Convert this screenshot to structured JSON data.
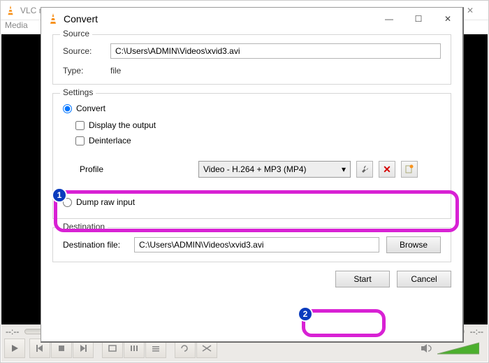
{
  "main": {
    "app_title": "VLC media player",
    "menubar_item": "Media",
    "time_left": "--:--",
    "time_right": "--:--"
  },
  "dialog": {
    "title": "Convert",
    "groups": {
      "source": {
        "legend": "Source",
        "source_label": "Source:",
        "source_value": "C:\\Users\\ADMIN\\Videos\\xvid3.avi",
        "type_label": "Type:",
        "type_value": "file"
      },
      "settings": {
        "legend": "Settings",
        "convert_radio": "Convert",
        "display_output_cb": "Display the output",
        "deinterlace_cb": "Deinterlace",
        "profile_label": "Profile",
        "profile_value": "Video - H.264 + MP3 (MP4)",
        "dump_raw_radio": "Dump raw input"
      },
      "destination": {
        "legend": "Destination",
        "dest_label": "Destination file:",
        "dest_value": "C:\\Users\\ADMIN\\Videos\\xvid3.avi",
        "browse_btn": "Browse"
      }
    },
    "footer": {
      "start_btn": "Start",
      "cancel_btn": "Cancel"
    }
  },
  "annotations": {
    "badge1": "1",
    "badge2": "2"
  },
  "winctrl": {
    "min": "—",
    "max": "☐",
    "close": "✕"
  }
}
